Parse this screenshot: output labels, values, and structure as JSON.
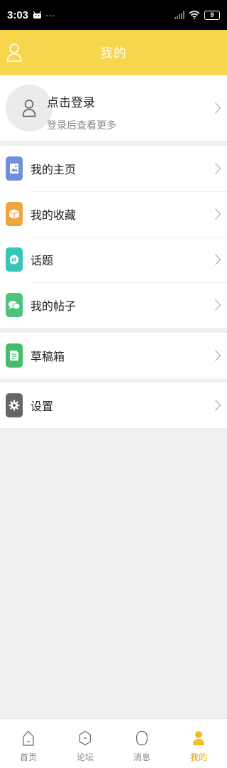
{
  "status_bar": {
    "time": "3:03",
    "dots": "···",
    "battery": "9"
  },
  "header": {
    "title": "我的"
  },
  "login": {
    "title": "点击登录",
    "subtitle": "登录后查看更多"
  },
  "menu_group_1": [
    {
      "label": "我的主页",
      "icon": "homepage-icon",
      "color": "#6f8fd8"
    },
    {
      "label": "我的收藏",
      "icon": "favorites-icon",
      "color": "#f0a53a"
    },
    {
      "label": "话题",
      "icon": "topic-icon",
      "color": "#34c7b8"
    },
    {
      "label": "我的帖子",
      "icon": "posts-icon",
      "color": "#4dc47a"
    }
  ],
  "menu_group_2": [
    {
      "label": "草稿箱",
      "icon": "drafts-icon",
      "color": "#45bd6a"
    }
  ],
  "menu_group_3": [
    {
      "label": "设置",
      "icon": "gear-icon",
      "color": "#666666"
    }
  ],
  "tabbar": [
    {
      "label": "首页",
      "icon": "home-icon",
      "active": false
    },
    {
      "label": "论坛",
      "icon": "forum-icon",
      "active": false
    },
    {
      "label": "消息",
      "icon": "message-icon",
      "active": false
    },
    {
      "label": "我的",
      "icon": "profile-icon",
      "active": true
    }
  ],
  "colors": {
    "accent": "#f7d64d",
    "active_tab": "#e0a100",
    "background": "#f0f0f0"
  }
}
